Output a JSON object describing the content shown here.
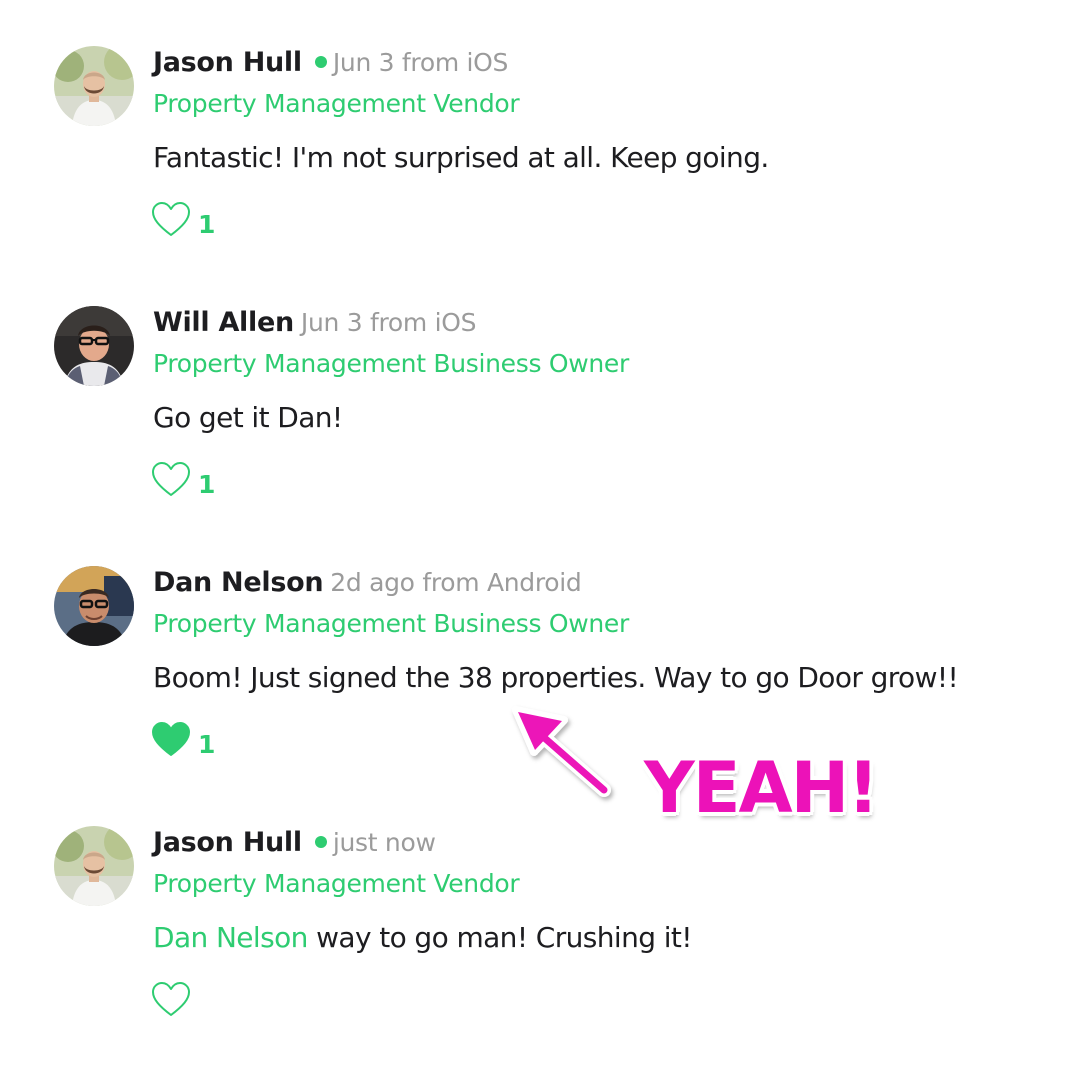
{
  "colors": {
    "accent": "#2ecc71",
    "name": "#1d1d20",
    "meta": "#9b9b9b",
    "highlight": "#ec12b8"
  },
  "comments": [
    {
      "author": "Jason Hull",
      "online": true,
      "meta": "Jun 3 from iOS",
      "role": "Property Management Vendor",
      "text": "Fantastic! I'm not surprised at all. Keep going.",
      "liked": false,
      "likes": "1"
    },
    {
      "author": "Will Allen",
      "online": false,
      "meta": "Jun 3 from iOS",
      "role": "Property Management Business Owner",
      "text": "Go get it Dan!",
      "liked": false,
      "likes": "1"
    },
    {
      "author": "Dan Nelson",
      "online": false,
      "meta": "2d ago from Android",
      "role": "Property Management Business Owner",
      "text": "Boom! Just signed the 38 properties. Way to go Door grow!!",
      "liked": true,
      "likes": "1"
    },
    {
      "author": "Jason Hull",
      "online": true,
      "meta": "just now",
      "role": "Property Management Vendor",
      "mention": "Dan Nelson",
      "text": " way to go man! Crushing it!",
      "liked": false,
      "likes": ""
    }
  ],
  "annotation": {
    "text": "YEAH!",
    "icon": "arrow-icon"
  }
}
